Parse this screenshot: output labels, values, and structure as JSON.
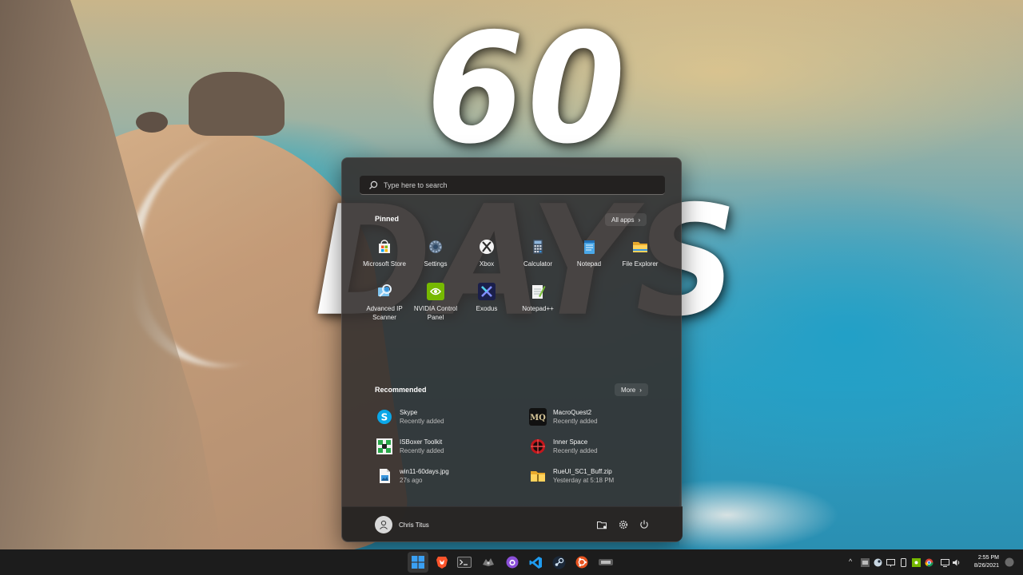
{
  "overlay": {
    "title": "60 DAYS"
  },
  "search": {
    "placeholder": "Type here to search"
  },
  "pinned": {
    "title": "Pinned",
    "all_apps_label": "All apps",
    "apps": [
      {
        "label": "Microsoft Store",
        "icon": "microsoft-store-icon"
      },
      {
        "label": "Settings",
        "icon": "settings-gear-icon"
      },
      {
        "label": "Xbox",
        "icon": "xbox-icon"
      },
      {
        "label": "Calculator",
        "icon": "calculator-icon"
      },
      {
        "label": "Notepad",
        "icon": "notepad-icon"
      },
      {
        "label": "File Explorer",
        "icon": "folder-icon"
      },
      {
        "label": "Advanced IP Scanner",
        "icon": "ip-scanner-icon"
      },
      {
        "label": "NVIDIA Control Panel",
        "icon": "nvidia-icon"
      },
      {
        "label": "Exodus",
        "icon": "exodus-icon"
      },
      {
        "label": "Notepad++",
        "icon": "notepad-plus-plus-icon"
      }
    ]
  },
  "recommended": {
    "title": "Recommended",
    "more_label": "More",
    "items": [
      {
        "name": "Skype",
        "sub": "Recently added",
        "icon": "skype-icon"
      },
      {
        "name": "MacroQuest2",
        "sub": "Recently added",
        "icon": "macroquest-icon"
      },
      {
        "name": "ISBoxer Toolkit",
        "sub": "Recently added",
        "icon": "isboxer-icon"
      },
      {
        "name": "Inner Space",
        "sub": "Recently added",
        "icon": "inner-space-icon"
      },
      {
        "name": "win11-60days.jpg",
        "sub": "27s ago",
        "icon": "image-file-icon"
      },
      {
        "name": "RueUI_SC1_Buff.zip",
        "sub": "Yesterday at 5:18 PM",
        "icon": "zip-folder-icon"
      }
    ]
  },
  "footer": {
    "user_name": "Chris Titus"
  },
  "taskbar": {
    "time": "2:55 PM",
    "date": "8/26/2021"
  },
  "colors": {
    "menu_bg": "#34302f",
    "accent_blue": "#3a96dd",
    "nvidia_green": "#76b900"
  }
}
